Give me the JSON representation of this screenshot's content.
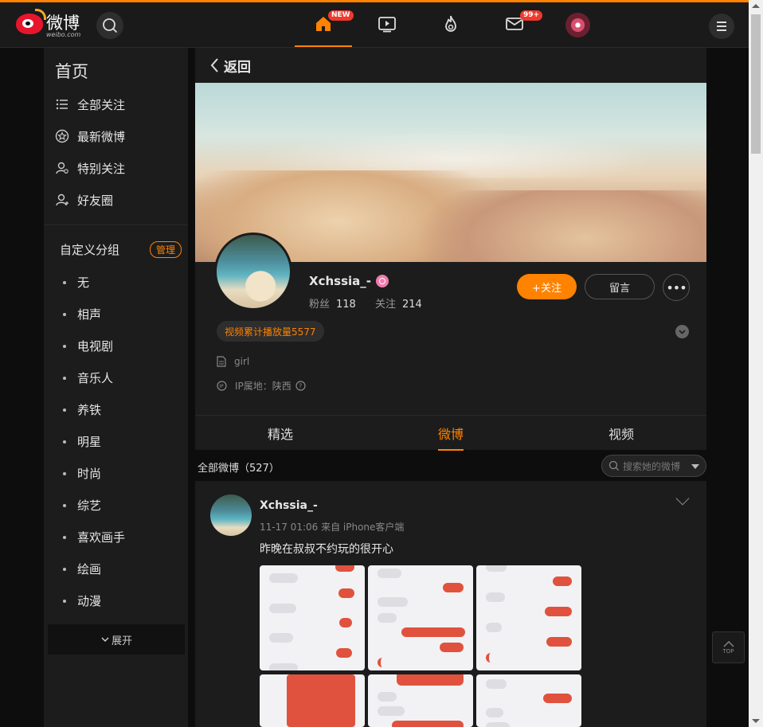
{
  "header": {
    "logo_text": "微博",
    "logo_sub": "weibo.com",
    "home_badge": "NEW",
    "mail_badge": "99+",
    "nav_icons": [
      "home-icon",
      "video-icon",
      "hot-icon",
      "mail-icon",
      "avatar"
    ],
    "accent": "#ff8200"
  },
  "sidebar": {
    "title": "首页",
    "items": [
      {
        "label": "全部关注",
        "icon": "list-icon"
      },
      {
        "label": "最新微博",
        "icon": "star-icon"
      },
      {
        "label": "特别关注",
        "icon": "special-user-icon"
      },
      {
        "label": "好友圈",
        "icon": "friends-icon"
      }
    ],
    "group_title": "自定义分组",
    "manage_label": "管理",
    "groups": [
      "无",
      "相声",
      "电视剧",
      "音乐人",
      "养铁",
      "明星",
      "时尚",
      "综艺",
      "喜欢画手",
      "绘画",
      "动漫"
    ],
    "expand_label": "展开"
  },
  "main": {
    "back_label": "返回",
    "profile": {
      "name": "Xchssia_-",
      "fans_label": "粉丝",
      "fans": "118",
      "following_label": "关注",
      "following": "214",
      "follow_button": "+关注",
      "message_button": "留言",
      "more_button": "•••",
      "tag": "视频累计播放量5577",
      "bio": "girl",
      "ip": "IP属地：陕西"
    },
    "tabs": [
      {
        "label": "精选",
        "active": false
      },
      {
        "label": "微博",
        "active": true
      },
      {
        "label": "视频",
        "active": false
      }
    ],
    "all_posts": "全部微博（527）",
    "search_placeholder": "搜索她的微博",
    "post": {
      "author": "Xchssia_-",
      "meta": "11-17 01:06 来自 iPhone客户端",
      "text": "昨晚在叔叔不约玩的很开心"
    }
  },
  "back_to_top": "TOP"
}
